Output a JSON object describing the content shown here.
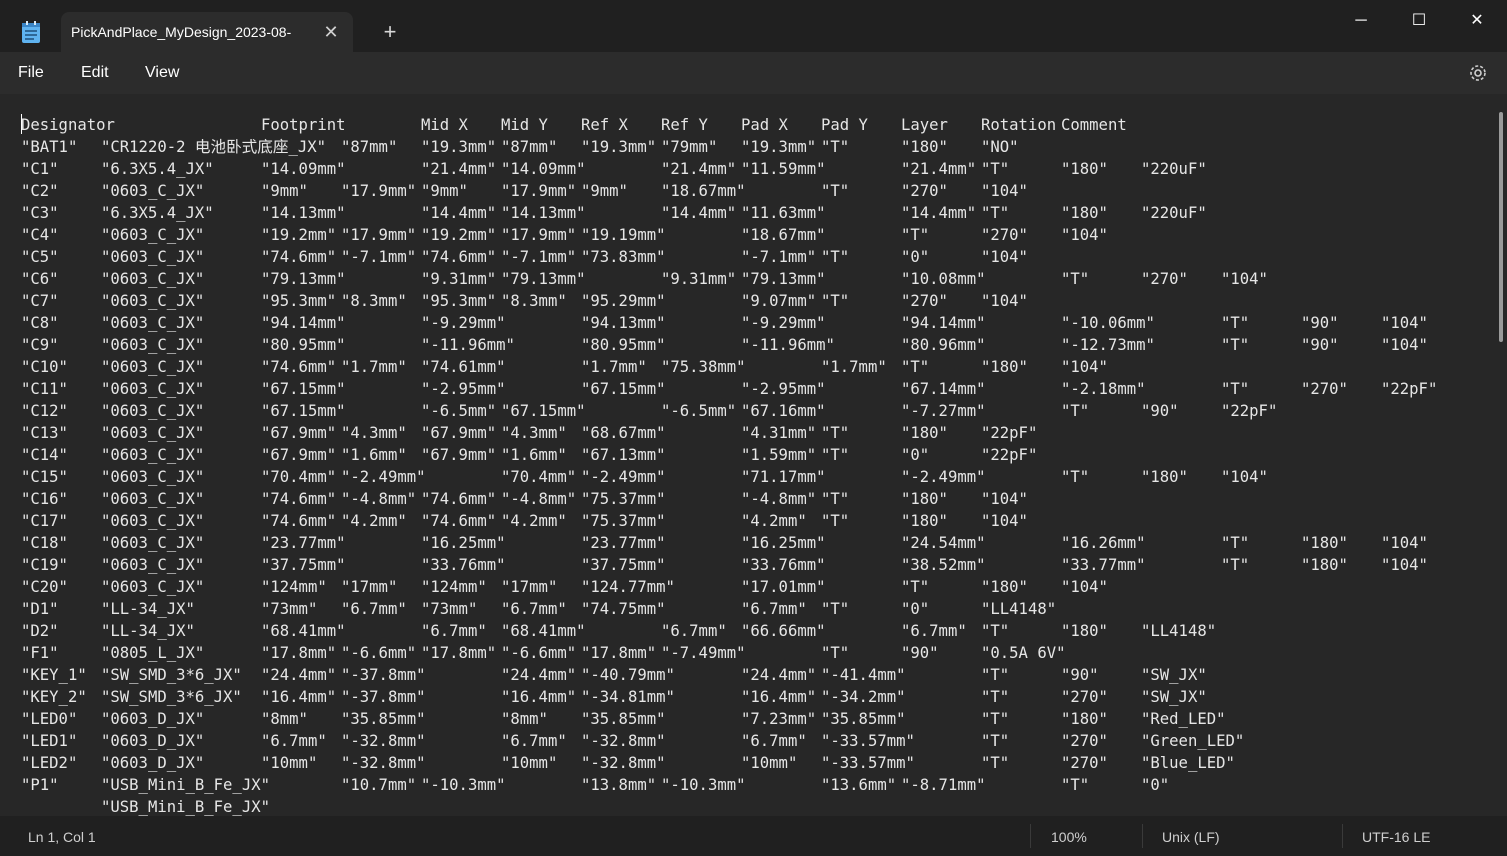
{
  "window": {
    "tab_title": "PickAndPlace_MyDesign_2023-08-",
    "close_tab_glyph": "✕",
    "new_tab_glyph": "+",
    "minimize_glyph": "─",
    "maximize_glyph": "☐",
    "close_glyph": "✕"
  },
  "menu": {
    "file": "File",
    "edit": "Edit",
    "view": "View"
  },
  "icons": {
    "app": "notepad-icon",
    "settings": "gear-icon"
  },
  "colors": {
    "background": "#1f1f1f",
    "editor": "#272727",
    "text": "#e6e6e6"
  },
  "header": [
    "Designator",
    "Footprint",
    "Mid X",
    "Mid Y",
    "Ref X",
    "Ref Y",
    "Pad X",
    "Pad Y",
    "Layer",
    "Rotation",
    "Comment"
  ],
  "rows": [
    [
      "\"BAT1\"",
      "\"CR1220-2 电池卧式底座_JX\"",
      "\"87mm\"",
      "\"19.3mm\"",
      "\"87mm\"",
      "\"19.3mm\"",
      "\"79mm\"",
      "\"19.3mm\"",
      "\"T\"",
      "\"180\"",
      "\"NO\""
    ],
    [
      "\"C1\"",
      "\"6.3X5.4_JX\"",
      "\"14.09mm\"",
      "\"21.4mm\"",
      "\"14.09mm\"",
      "\"21.4mm\"",
      "\"11.59mm\"",
      "\"21.4mm\"",
      "\"T\"",
      "\"180\"",
      "\"220uF\""
    ],
    [
      "\"C2\"",
      "\"0603_C_JX\"",
      "\"9mm\"",
      "\"17.9mm\"",
      "\"9mm\"",
      "\"17.9mm\"",
      "\"9mm\"",
      "\"18.67mm\"",
      "\"T\"",
      "\"270\"",
      "\"104\""
    ],
    [
      "\"C3\"",
      "\"6.3X5.4_JX\"",
      "\"14.13mm\"",
      "\"14.4mm\"",
      "\"14.13mm\"",
      "\"14.4mm\"",
      "\"11.63mm\"",
      "\"14.4mm\"",
      "\"T\"",
      "\"180\"",
      "\"220uF\""
    ],
    [
      "\"C4\"",
      "\"0603_C_JX\"",
      "\"19.2mm\"",
      "\"17.9mm\"",
      "\"19.2mm\"",
      "\"17.9mm\"",
      "\"19.19mm\"",
      "\"18.67mm\"",
      "\"T\"",
      "\"270\"",
      "\"104\""
    ],
    [
      "\"C5\"",
      "\"0603_C_JX\"",
      "\"74.6mm\"",
      "\"-7.1mm\"",
      "\"74.6mm\"",
      "\"-7.1mm\"",
      "\"73.83mm\"",
      "\"-7.1mm\"",
      "\"T\"",
      "\"0\"",
      "\"104\""
    ],
    [
      "\"C6\"",
      "\"0603_C_JX\"",
      "\"79.13mm\"",
      "\"9.31mm\"",
      "\"79.13mm\"",
      "\"9.31mm\"",
      "\"79.13mm\"",
      "\"10.08mm\"",
      "\"T\"",
      "\"270\"",
      "\"104\""
    ],
    [
      "\"C7\"",
      "\"0603_C_JX\"",
      "\"95.3mm\"",
      "\"8.3mm\"",
      "\"95.3mm\"",
      "\"8.3mm\"",
      "\"95.29mm\"",
      "\"9.07mm\"",
      "\"T\"",
      "\"270\"",
      "\"104\""
    ],
    [
      "\"C8\"",
      "\"0603_C_JX\"",
      "\"94.14mm\"",
      "\"-9.29mm\"",
      "\"94.13mm\"",
      "\"-9.29mm\"",
      "\"94.14mm\"",
      "\"-10.06mm\"",
      "\"T\"",
      "\"90\"",
      "\"104\""
    ],
    [
      "\"C9\"",
      "\"0603_C_JX\"",
      "\"80.95mm\"",
      "\"-11.96mm\"",
      "\"80.95mm\"",
      "\"-11.96mm\"",
      "\"80.96mm\"",
      "\"-12.73mm\"",
      "\"T\"",
      "\"90\"",
      "\"104\""
    ],
    [
      "\"C10\"",
      "\"0603_C_JX\"",
      "\"74.6mm\"",
      "\"1.7mm\"",
      "\"74.61mm\"",
      "\"1.7mm\"",
      "\"75.38mm\"",
      "\"1.7mm\"",
      "\"T\"",
      "\"180\"",
      "\"104\""
    ],
    [
      "\"C11\"",
      "\"0603_C_JX\"",
      "\"67.15mm\"",
      "\"-2.95mm\"",
      "\"67.15mm\"",
      "\"-2.95mm\"",
      "\"67.14mm\"",
      "\"-2.18mm\"",
      "\"T\"",
      "\"270\"",
      "\"22pF\""
    ],
    [
      "\"C12\"",
      "\"0603_C_JX\"",
      "\"67.15mm\"",
      "\"-6.5mm\"",
      "\"67.15mm\"",
      "\"-6.5mm\"",
      "\"67.16mm\"",
      "\"-7.27mm\"",
      "\"T\"",
      "\"90\"",
      "\"22pF\""
    ],
    [
      "\"C13\"",
      "\"0603_C_JX\"",
      "\"67.9mm\"",
      "\"4.3mm\"",
      "\"67.9mm\"",
      "\"4.3mm\"",
      "\"68.67mm\"",
      "\"4.31mm\"",
      "\"T\"",
      "\"180\"",
      "\"22pF\""
    ],
    [
      "\"C14\"",
      "\"0603_C_JX\"",
      "\"67.9mm\"",
      "\"1.6mm\"",
      "\"67.9mm\"",
      "\"1.6mm\"",
      "\"67.13mm\"",
      "\"1.59mm\"",
      "\"T\"",
      "\"0\"",
      "\"22pF\""
    ],
    [
      "\"C15\"",
      "\"0603_C_JX\"",
      "\"70.4mm\"",
      "\"-2.49mm\"",
      "\"70.4mm\"",
      "\"-2.49mm\"",
      "\"71.17mm\"",
      "\"-2.49mm\"",
      "\"T\"",
      "\"180\"",
      "\"104\""
    ],
    [
      "\"C16\"",
      "\"0603_C_JX\"",
      "\"74.6mm\"",
      "\"-4.8mm\"",
      "\"74.6mm\"",
      "\"-4.8mm\"",
      "\"75.37mm\"",
      "\"-4.8mm\"",
      "\"T\"",
      "\"180\"",
      "\"104\""
    ],
    [
      "\"C17\"",
      "\"0603_C_JX\"",
      "\"74.6mm\"",
      "\"4.2mm\"",
      "\"74.6mm\"",
      "\"4.2mm\"",
      "\"75.37mm\"",
      "\"4.2mm\"",
      "\"T\"",
      "\"180\"",
      "\"104\""
    ],
    [
      "\"C18\"",
      "\"0603_C_JX\"",
      "\"23.77mm\"",
      "\"16.25mm\"",
      "\"23.77mm\"",
      "\"16.25mm\"",
      "\"24.54mm\"",
      "\"16.26mm\"",
      "\"T\"",
      "\"180\"",
      "\"104\""
    ],
    [
      "\"C19\"",
      "\"0603_C_JX\"",
      "\"37.75mm\"",
      "\"33.76mm\"",
      "\"37.75mm\"",
      "\"33.76mm\"",
      "\"38.52mm\"",
      "\"33.77mm\"",
      "\"T\"",
      "\"180\"",
      "\"104\""
    ],
    [
      "\"C20\"",
      "\"0603_C_JX\"",
      "\"124mm\"",
      "\"17mm\"",
      "\"124mm\"",
      "\"17mm\"",
      "\"124.77mm\"",
      "\"17.01mm\"",
      "\"T\"",
      "\"180\"",
      "\"104\""
    ],
    [
      "\"D1\"",
      "\"LL-34_JX\"",
      "\"73mm\"",
      "\"6.7mm\"",
      "\"73mm\"",
      "\"6.7mm\"",
      "\"74.75mm\"",
      "\"6.7mm\"",
      "\"T\"",
      "\"0\"",
      "\"LL4148\""
    ],
    [
      "\"D2\"",
      "\"LL-34_JX\"",
      "\"68.41mm\"",
      "\"6.7mm\"",
      "\"68.41mm\"",
      "\"6.7mm\"",
      "\"66.66mm\"",
      "\"6.7mm\"",
      "\"T\"",
      "\"180\"",
      "\"LL4148\""
    ],
    [
      "\"F1\"",
      "\"0805_L_JX\"",
      "\"17.8mm\"",
      "\"-6.6mm\"",
      "\"17.8mm\"",
      "\"-6.6mm\"",
      "\"17.8mm\"",
      "\"-7.49mm\"",
      "\"T\"",
      "\"90\"",
      "\"0.5A 6V\""
    ],
    [
      "\"KEY_1\"",
      "\"SW_SMD_3*6_JX\"",
      "\"24.4mm\"",
      "\"-37.8mm\"",
      "\"24.4mm\"",
      "\"-40.79mm\"",
      "\"24.4mm\"",
      "\"-41.4mm\"",
      "\"T\"",
      "\"90\"",
      "\"SW_JX\""
    ],
    [
      "\"KEY_2\"",
      "\"SW_SMD_3*6_JX\"",
      "\"16.4mm\"",
      "\"-37.8mm\"",
      "\"16.4mm\"",
      "\"-34.81mm\"",
      "\"16.4mm\"",
      "\"-34.2mm\"",
      "\"T\"",
      "\"270\"",
      "\"SW_JX\""
    ],
    [
      "\"LED0\"",
      "\"0603_D_JX\"",
      "\"8mm\"",
      "\"35.85mm\"",
      "\"8mm\"",
      "\"35.85mm\"",
      "\"7.23mm\"",
      "\"35.85mm\"",
      "\"T\"",
      "\"180\"",
      "\"Red_LED\""
    ],
    [
      "\"LED1\"",
      "\"0603_D_JX\"",
      "\"6.7mm\"",
      "\"-32.8mm\"",
      "\"6.7mm\"",
      "\"-32.8mm\"",
      "\"6.7mm\"",
      "\"-33.57mm\"",
      "\"T\"",
      "\"270\"",
      "\"Green_LED\""
    ],
    [
      "\"LED2\"",
      "\"0603_D_JX\"",
      "\"10mm\"",
      "\"-32.8mm\"",
      "\"10mm\"",
      "\"-32.8mm\"",
      "\"10mm\"",
      "\"-33.57mm\"",
      "\"T\"",
      "\"270\"",
      "\"Blue_LED\""
    ],
    [
      "\"P1\"",
      "\"USB_Mini_B_Fe_JX\"",
      "\"10.7mm\"",
      "\"-10.3mm\"",
      "\"13.8mm\"",
      "\"-10.3mm\"",
      "\"13.6mm\"",
      "\"-8.71mm\"",
      "\"T\"",
      "\"0\"",
      ""
    ],
    [
      "",
      "\"USB_Mini_B_Fe_JX\"",
      "",
      "",
      "",
      "",
      "",
      "",
      "",
      "",
      ""
    ]
  ],
  "status": {
    "position": "Ln 1, Col 1",
    "zoom": "100%",
    "line_ending": "Unix (LF)",
    "encoding": "UTF-16 LE"
  }
}
